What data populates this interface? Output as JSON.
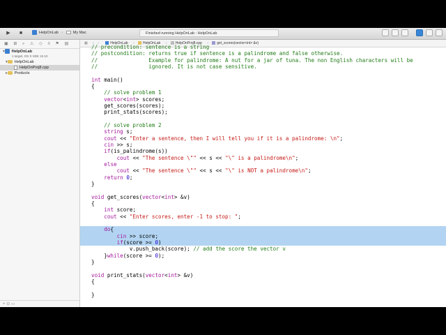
{
  "toolbar": {
    "run_icon": "play-icon",
    "stop_icon": "stop-icon",
    "scheme_target": "HelpOnLab",
    "scheme_device": "My Mac",
    "activity_status": "Finished running HelpOnLab : HelpOnLab"
  },
  "navigator": {
    "project_name": "HelpOnLab",
    "project_subtitle": "1 target, OS X SDK 10.10",
    "group_name": "HelpOnLab",
    "file_name": "HelpOnProj8.cpp",
    "products_name": "Products",
    "filter_icons": "+  ⊙  ▭"
  },
  "jumpbar": {
    "crumbs": [
      "HelpOnLab",
      "HelpOnLab",
      "HelpOnProj8.cpp",
      "get_scores(vector<int> &v)"
    ]
  },
  "code_lines": [
    {
      "segments": [
        {
          "c": "cm",
          "t": "// precondition: sentence is a string"
        }
      ]
    },
    {
      "segments": [
        {
          "c": "cm",
          "t": "// postcondition: returns true if sentence is a palindrome and false otherwise."
        }
      ]
    },
    {
      "segments": [
        {
          "c": "cm",
          "t": "//                Example for palindrome: A nut for a jar of tuna. The non English characters will be"
        }
      ]
    },
    {
      "segments": [
        {
          "c": "cm",
          "t": "//                ignored. It is not case sensitive."
        }
      ]
    },
    {
      "segments": []
    },
    {
      "segments": [
        {
          "c": "ty",
          "t": "int"
        },
        {
          "c": "",
          "t": " main()"
        }
      ]
    },
    {
      "segments": [
        {
          "c": "",
          "t": "{"
        }
      ]
    },
    {
      "segments": [
        {
          "c": "cm",
          "t": "    // solve problem 1"
        }
      ]
    },
    {
      "segments": [
        {
          "c": "",
          "t": "    "
        },
        {
          "c": "ty",
          "t": "vector"
        },
        {
          "c": "",
          "t": "<"
        },
        {
          "c": "ty",
          "t": "int"
        },
        {
          "c": "",
          "t": "> scores;"
        }
      ]
    },
    {
      "segments": [
        {
          "c": "",
          "t": "    get_scores(scores);"
        }
      ]
    },
    {
      "segments": [
        {
          "c": "",
          "t": "    print_stats(scores);"
        }
      ]
    },
    {
      "segments": []
    },
    {
      "segments": [
        {
          "c": "cm",
          "t": "    // solve problem 2"
        }
      ]
    },
    {
      "segments": [
        {
          "c": "",
          "t": "    "
        },
        {
          "c": "ty",
          "t": "string"
        },
        {
          "c": "",
          "t": " s;"
        }
      ]
    },
    {
      "segments": [
        {
          "c": "",
          "t": "    "
        },
        {
          "c": "ty",
          "t": "cout"
        },
        {
          "c": "",
          "t": " << "
        },
        {
          "c": "st",
          "t": "\"Enter a sentence, then I will tell you if it is a palindrome: \\n\""
        },
        {
          "c": "",
          "t": ";"
        }
      ]
    },
    {
      "segments": [
        {
          "c": "",
          "t": "    "
        },
        {
          "c": "ty",
          "t": "cin"
        },
        {
          "c": "",
          "t": " >> s;"
        }
      ]
    },
    {
      "segments": [
        {
          "c": "",
          "t": "    "
        },
        {
          "c": "kw",
          "t": "if"
        },
        {
          "c": "",
          "t": "(is_palindrome(s))"
        }
      ]
    },
    {
      "segments": [
        {
          "c": "",
          "t": "        "
        },
        {
          "c": "ty",
          "t": "cout"
        },
        {
          "c": "",
          "t": " << "
        },
        {
          "c": "st",
          "t": "\"The sentence \\\"\""
        },
        {
          "c": "",
          "t": " << s << "
        },
        {
          "c": "st",
          "t": "\"\\\" is a palindrome\\n\""
        },
        {
          "c": "",
          "t": ";"
        }
      ]
    },
    {
      "segments": [
        {
          "c": "",
          "t": "    "
        },
        {
          "c": "kw",
          "t": "else"
        }
      ]
    },
    {
      "segments": [
        {
          "c": "",
          "t": "        "
        },
        {
          "c": "ty",
          "t": "cout"
        },
        {
          "c": "",
          "t": " << "
        },
        {
          "c": "st",
          "t": "\"The sentence \\\"\""
        },
        {
          "c": "",
          "t": " << s << "
        },
        {
          "c": "st",
          "t": "\"\\\" is NOT a palindrome\\n\""
        },
        {
          "c": "",
          "t": ";"
        }
      ]
    },
    {
      "segments": [
        {
          "c": "",
          "t": "    "
        },
        {
          "c": "kw",
          "t": "return"
        },
        {
          "c": "",
          "t": " "
        },
        {
          "c": "nm",
          "t": "0"
        },
        {
          "c": "",
          "t": ";"
        }
      ]
    },
    {
      "segments": [
        {
          "c": "",
          "t": "}"
        }
      ]
    },
    {
      "segments": []
    },
    {
      "segments": [
        {
          "c": "ty",
          "t": "void"
        },
        {
          "c": "",
          "t": " get_scores("
        },
        {
          "c": "ty",
          "t": "vector"
        },
        {
          "c": "",
          "t": "<"
        },
        {
          "c": "ty",
          "t": "int"
        },
        {
          "c": "",
          "t": "> &v)"
        }
      ]
    },
    {
      "segments": [
        {
          "c": "",
          "t": "{"
        }
      ]
    },
    {
      "segments": [
        {
          "c": "",
          "t": "    "
        },
        {
          "c": "ty",
          "t": "int"
        },
        {
          "c": "",
          "t": " score;"
        }
      ]
    },
    {
      "segments": [
        {
          "c": "",
          "t": "    "
        },
        {
          "c": "ty",
          "t": "cout"
        },
        {
          "c": "",
          "t": " << "
        },
        {
          "c": "st",
          "t": "\"Enter scores, enter -1 to stop: \""
        },
        {
          "c": "",
          "t": ";"
        }
      ]
    },
    {
      "segments": []
    },
    {
      "sel": true,
      "segments": [
        {
          "c": "",
          "t": "    "
        },
        {
          "c": "kw",
          "t": "do"
        },
        {
          "c": "",
          "t": "{"
        }
      ]
    },
    {
      "sel": true,
      "segments": [
        {
          "c": "",
          "t": "        "
        },
        {
          "c": "ty",
          "t": "cin"
        },
        {
          "c": "",
          "t": " >> score;"
        }
      ]
    },
    {
      "sel": true,
      "segments": [
        {
          "c": "",
          "t": "        "
        },
        {
          "c": "kw",
          "t": "if"
        },
        {
          "c": "",
          "t": "(score >= "
        },
        {
          "c": "nm",
          "t": "0"
        },
        {
          "c": "",
          "t": ")"
        }
      ]
    },
    {
      "segments": [
        {
          "c": "",
          "t": "            v.push_back(score); "
        },
        {
          "c": "cm",
          "t": "// add the score the vector v"
        }
      ]
    },
    {
      "segments": [
        {
          "c": "",
          "t": "    }"
        },
        {
          "c": "kw",
          "t": "while"
        },
        {
          "c": "",
          "t": "(score >= "
        },
        {
          "c": "nm",
          "t": "0"
        },
        {
          "c": "",
          "t": ");"
        }
      ]
    },
    {
      "segments": [
        {
          "c": "",
          "t": "}"
        }
      ]
    },
    {
      "segments": []
    },
    {
      "segments": [
        {
          "c": "ty",
          "t": "void"
        },
        {
          "c": "",
          "t": " print_stats("
        },
        {
          "c": "ty",
          "t": "vector"
        },
        {
          "c": "",
          "t": "<"
        },
        {
          "c": "ty",
          "t": "int"
        },
        {
          "c": "",
          "t": "> &v)"
        }
      ]
    },
    {
      "segments": [
        {
          "c": "",
          "t": "{"
        }
      ]
    },
    {
      "segments": []
    },
    {
      "segments": [
        {
          "c": "",
          "t": "}"
        }
      ]
    }
  ]
}
